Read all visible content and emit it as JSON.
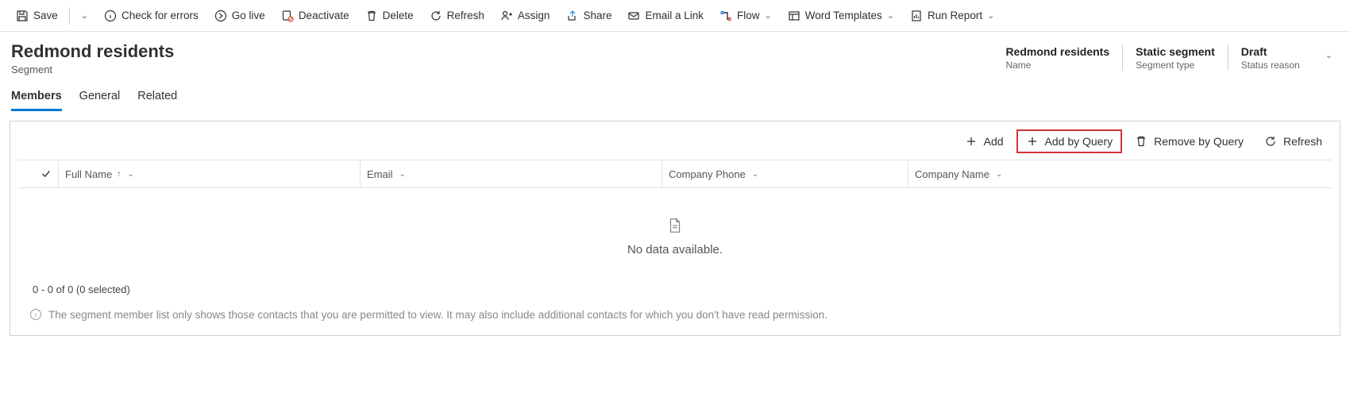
{
  "commands": {
    "save": "Save",
    "check_errors": "Check for errors",
    "go_live": "Go live",
    "deactivate": "Deactivate",
    "delete": "Delete",
    "refresh": "Refresh",
    "assign": "Assign",
    "share": "Share",
    "email_link": "Email a Link",
    "flow": "Flow",
    "word_templates": "Word Templates",
    "run_report": "Run Report"
  },
  "header": {
    "title": "Redmond residents",
    "subtitle": "Segment",
    "fields": {
      "name": {
        "value": "Redmond residents",
        "label": "Name"
      },
      "segment_type": {
        "value": "Static segment",
        "label": "Segment type"
      },
      "status_reason": {
        "value": "Draft",
        "label": "Status reason"
      }
    }
  },
  "tabs": {
    "members": "Members",
    "general": "General",
    "related": "Related"
  },
  "grid": {
    "toolbar": {
      "add": "Add",
      "add_by_query": "Add by Query",
      "remove_by_query": "Remove by Query",
      "refresh": "Refresh"
    },
    "columns": {
      "full_name": "Full Name",
      "email": "Email",
      "company_phone": "Company Phone",
      "company_name": "Company Name"
    },
    "empty_text": "No data available.",
    "footer_count": "0 - 0 of 0 (0 selected)",
    "permission_note": "The segment member list only shows those contacts that you are permitted to view. It may also include additional contacts for which you don't have read permission."
  }
}
